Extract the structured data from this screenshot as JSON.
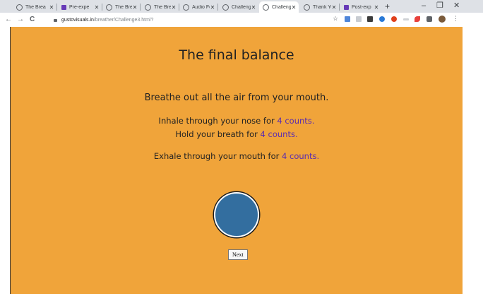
{
  "browser": {
    "tabs": [
      {
        "title": "The Brea",
        "favicon": "globe-icon",
        "active": false
      },
      {
        "title": "Pre-expe",
        "favicon": "google-forms-icon",
        "active": false
      },
      {
        "title": "The Brea",
        "favicon": "globe-icon",
        "active": false
      },
      {
        "title": "The Brea",
        "favicon": "globe-icon",
        "active": false
      },
      {
        "title": "Audio Fe",
        "favicon": "globe-icon",
        "active": false
      },
      {
        "title": "Challeng",
        "favicon": "globe-icon",
        "active": false
      },
      {
        "title": "Challeng",
        "favicon": "globe-icon",
        "active": true
      },
      {
        "title": "Thank Yo",
        "favicon": "globe-icon",
        "active": false
      },
      {
        "title": "Post-exp",
        "favicon": "google-forms-icon",
        "active": false
      }
    ],
    "tab_close_glyph": "✕",
    "new_tab_glyph": "+",
    "window": {
      "minimize": "–",
      "maximize": "❐",
      "close": "✕"
    },
    "nav": {
      "back": "←",
      "forward": "→",
      "reload": "C"
    },
    "url_host": "gustovisuals.in",
    "url_path": "/breather/Challenge3.html?",
    "star_glyph": "☆",
    "menu_glyph": "⋮"
  },
  "page": {
    "title": "The final balance",
    "line1": "Breathe out all the air from your mouth.",
    "line2_pre": "Inhale through your nose for ",
    "line2_hl": "4 counts.",
    "line3_pre": "Hold your breath for ",
    "line3_hl": "4 counts.",
    "line4_pre": "Exhale through your mouth for ",
    "line4_hl": "4 counts.",
    "next_button": "Next"
  },
  "colors": {
    "page_background": "#f0a43a",
    "highlight_text": "#5a2cb0",
    "circle_fill": "#336e9f"
  }
}
